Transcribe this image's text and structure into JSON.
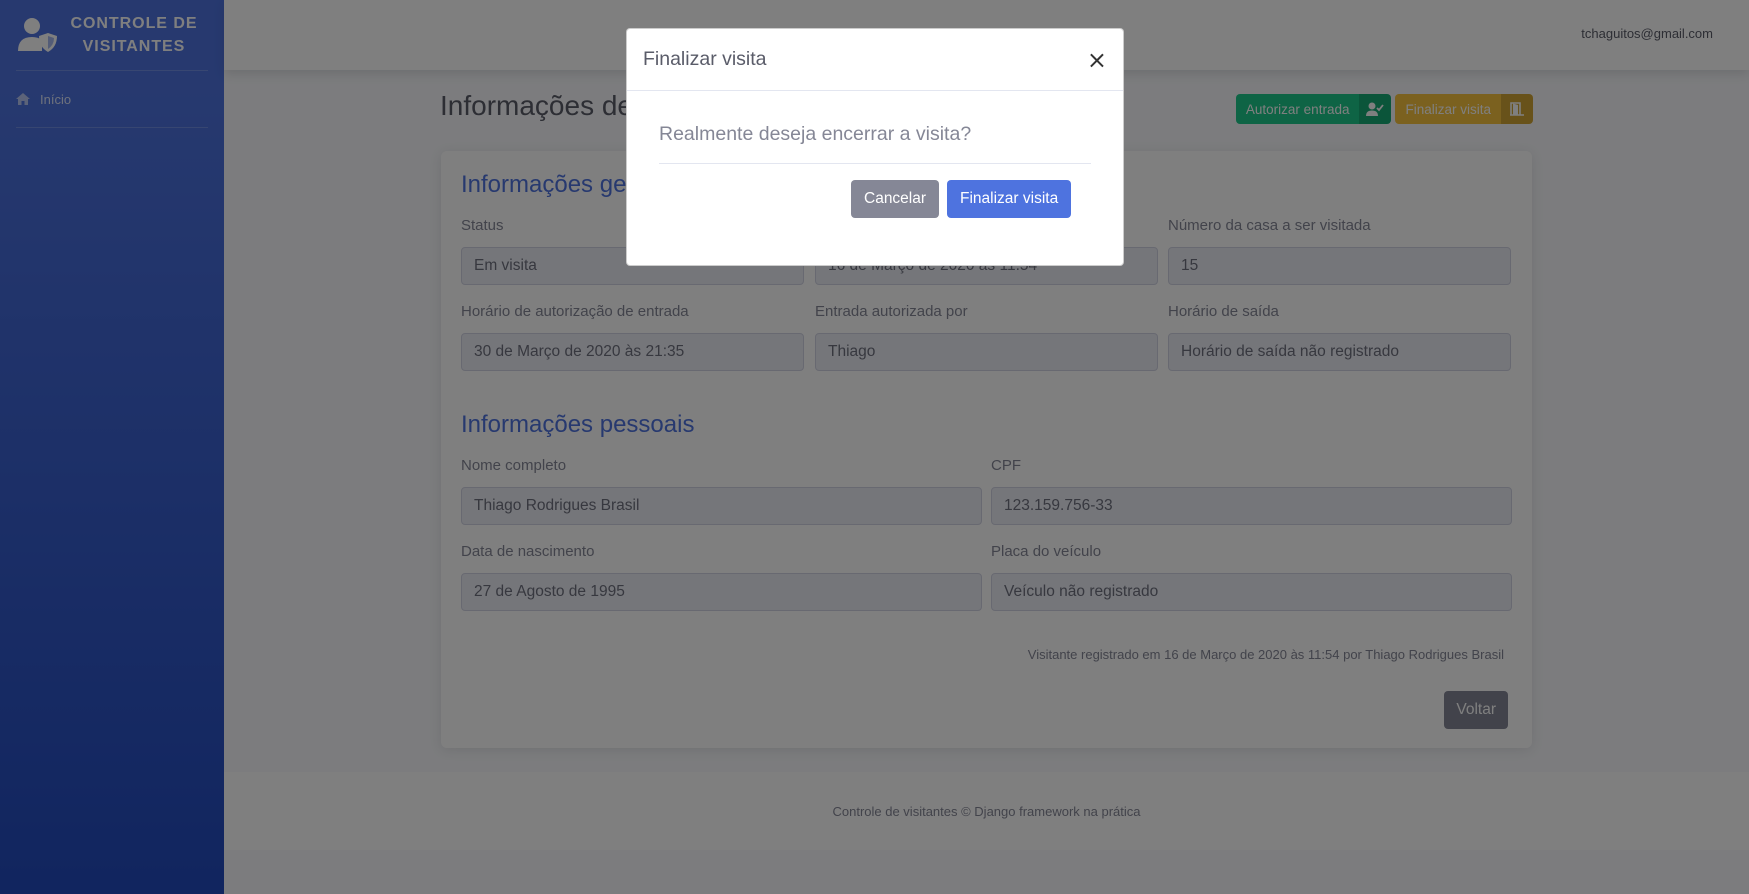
{
  "sidebar": {
    "brand": "CONTROLE DE VISITANTES",
    "items": [
      {
        "label": "Início",
        "icon": "home-icon"
      }
    ]
  },
  "topbar": {
    "user_email": "tchaguitos@gmail.com"
  },
  "page": {
    "title": "Informações de",
    "actions": {
      "authorize_label": "Autorizar entrada",
      "finish_label": "Finalizar visita"
    }
  },
  "general": {
    "title": "Informações ge",
    "fields": [
      {
        "label": "Status",
        "value": "Em visita"
      },
      {
        "label": "",
        "value": "16 de Março de 2020 às 11:54"
      },
      {
        "label": "Número da casa a ser visitada",
        "value": "15"
      },
      {
        "label": "Horário de autorização de entrada",
        "value": "30 de Março de 2020 às 21:35"
      },
      {
        "label": "Entrada autorizada por",
        "value": "Thiago"
      },
      {
        "label": "Horário de saída",
        "value": "Horário de saída não registrado"
      }
    ]
  },
  "personal": {
    "title": "Informações pessoais",
    "fields": [
      {
        "label": "Nome completo",
        "value": "Thiago Rodrigues Brasil"
      },
      {
        "label": "CPF",
        "value": "123.159.756-33"
      },
      {
        "label": "Data de nascimento",
        "value": "27 de Agosto de 1995"
      },
      {
        "label": "Placa do veículo",
        "value": "Veículo não registrado"
      }
    ]
  },
  "registered_note": "Visitante registrado em 16 de Março de 2020 às 11:54 por Thiago Rodrigues Brasil",
  "back_label": "Voltar",
  "footer": "Controle de visitantes © Django framework na prática",
  "modal": {
    "title": "Finalizar visita",
    "close": "×",
    "question": "Realmente deseja encerrar a visita?",
    "cancel_label": "Cancelar",
    "confirm_label": "Finalizar visita"
  },
  "colors": {
    "primary": "#4e73df",
    "success": "#1cc88a",
    "warning": "#f6c23e",
    "secondary": "#858796"
  }
}
